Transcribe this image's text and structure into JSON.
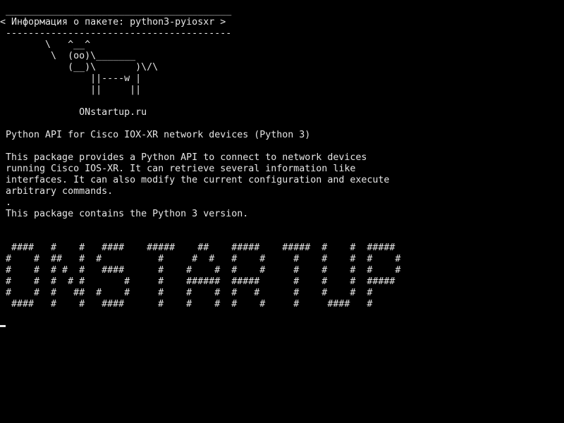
{
  "terminal": {
    "lines": [
      " ________________________________________",
      "< Информация о пакете: python3-pyiosxr >",
      " ----------------------------------------",
      "        \\   ^__^",
      "         \\  (oo)\\_______",
      "            (__)\\       )\\/\\",
      "                ||----w |",
      "                ||     ||",
      "",
      "              ONstartup.ru",
      "",
      " Python API for Cisco IOX-XR network devices (Python 3)",
      "",
      " This package provides a Python API to connect to network devices",
      " running Cisco IOS-XR. It can retrieve several information like",
      " interfaces. It can also modify the current configuration and execute",
      " arbitrary commands.",
      " .",
      " This package contains the Python 3 version.",
      "",
      "",
      "  ####   #    #   ####    #####    ##    #####    #####  #    #  #####",
      " #    #  ##   #  #          #     #  #   #    #     #    #    #  #    #",
      " #    #  # #  #   ####      #    #    #  #    #     #    #    #  #    #",
      " #    #  #  # #       #     #    ######  #####      #    #    #  #####",
      " #    #  #   ##  #    #     #    #    #  #   #      #    #    #  #",
      "  ####   #    #   ####      #    #    #  #    #     #     ####   #"
    ]
  }
}
